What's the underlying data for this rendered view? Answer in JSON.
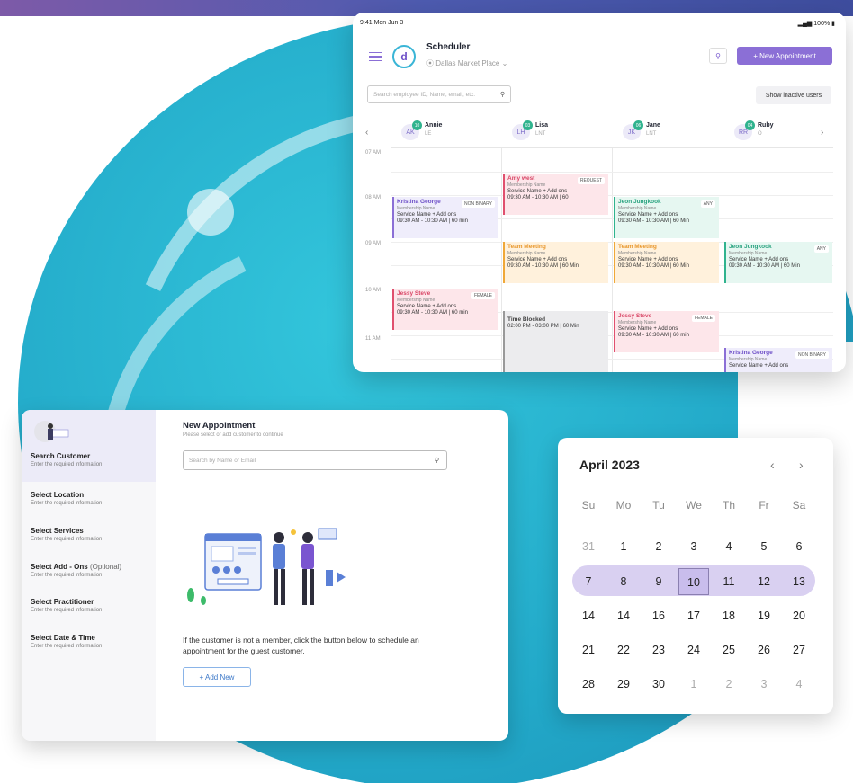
{
  "colors": {
    "accent": "#8b6fd6",
    "teal": "#22a8c8"
  },
  "scheduler": {
    "status_time": "9:41  Mon Jun 3",
    "status_right": "100%",
    "logo": "d",
    "title": "Scheduler",
    "location": "Dallas Market Place",
    "new_button": "+ New Appointment",
    "search_placeholder": "Search employee ID, Name, email, etc.",
    "inactive_button": "Show inactive users",
    "staff": [
      {
        "initials": "AK",
        "badge": "10",
        "name": "Annie",
        "role": "LE"
      },
      {
        "initials": "LH",
        "badge": "03",
        "name": "Lisa",
        "role": "LNT"
      },
      {
        "initials": "JK",
        "badge": "06",
        "name": "Jane",
        "role": "LNT"
      },
      {
        "initials": "RR",
        "badge": "04",
        "name": "Ruby",
        "role": "O"
      }
    ],
    "times": [
      "07 AM",
      "08 AM",
      "09 AM",
      "10 AM",
      "11 AM"
    ],
    "events": [
      {
        "name": "Kristina George",
        "member": "Membership Name",
        "service": "Service Name + Add ons",
        "time": "09:30 AM - 10:30 AM | 60 min",
        "tag": "NON BINARY"
      },
      {
        "name": "Amy west",
        "member": "Membership Name",
        "service": "Service Name + Add ons",
        "time": "09:30 AM - 10:30 AM | 60",
        "tag": "REQUEST"
      },
      {
        "name": "Jeon Jungkook",
        "member": "Membership Name",
        "service": "Service Name + Add ons",
        "time": "09:30 AM - 10:30 AM | 60 Min",
        "tag": "ANY"
      },
      {
        "name": "Team Meeting",
        "member": "Membership Name",
        "service": "Service Name + Add ons",
        "time": "09:30 AM - 10:30 AM | 60 Min"
      },
      {
        "name": "Team Meeting",
        "member": "Membership Name",
        "service": "Service Name + Add ons",
        "time": "09:30 AM - 10:30 AM | 60 Min"
      },
      {
        "name": "Jeon Jungkook",
        "member": "Membership Name",
        "service": "Service Name + Add ons",
        "time": "09:30 AM - 10:30 AM | 60 Min",
        "tag": "ANY"
      },
      {
        "name": "Jessy Steve",
        "member": "Membership Name",
        "service": "Service Name + Add ons",
        "time": "09:30 AM - 10:30 AM | 60 min",
        "tag": "FEMALE"
      },
      {
        "name": "Time Blocked",
        "time": "02:00 PM - 03:00 PM | 60 Min"
      },
      {
        "name": "Jessy Steve",
        "member": "Membership Name",
        "service": "Service Name + Add ons",
        "time": "09:30 AM - 10:30 AM | 60 min",
        "tag": "FEMALE"
      },
      {
        "name": "Kristina George",
        "member": "Membership Name",
        "service": "Service Name + Add ons",
        "tag": "NON BINARY"
      }
    ]
  },
  "appointment": {
    "title": "New Appointment",
    "subtitle": "Please select or add customer to continue",
    "search_placeholder": "Search by Name or Email",
    "steps": [
      {
        "title": "Search Customer",
        "desc": "Enter the required information"
      },
      {
        "title": "Select Location",
        "desc": "Enter the required information"
      },
      {
        "title": "Select Services",
        "desc": "Enter the required information"
      },
      {
        "title": "Select Add - Ons",
        "optional": "(Optional)",
        "desc": "Enter the required information"
      },
      {
        "title": "Select Practitioner",
        "desc": "Enter the required information"
      },
      {
        "title": "Select Date & Time",
        "desc": "Enter the required information"
      }
    ],
    "message": "If the customer is not a member, click the button below to schedule an appointment for the guest customer.",
    "add_button": "+ Add New"
  },
  "calendar": {
    "month": "April  2023",
    "prev": "‹",
    "next": "›",
    "weekdays": [
      "Su",
      "Mo",
      "Tu",
      "We",
      "Th",
      "Fr",
      "Sa"
    ],
    "weeks": [
      [
        "31",
        "1",
        "2",
        "3",
        "4",
        "5",
        "6"
      ],
      [
        "7",
        "8",
        "9",
        "10",
        "11",
        "12",
        "13"
      ],
      [
        "14",
        "14",
        "16",
        "17",
        "18",
        "19",
        "20"
      ],
      [
        "21",
        "22",
        "23",
        "24",
        "25",
        "26",
        "27"
      ],
      [
        "28",
        "29",
        "30",
        "1",
        "2",
        "3",
        "4"
      ]
    ]
  }
}
